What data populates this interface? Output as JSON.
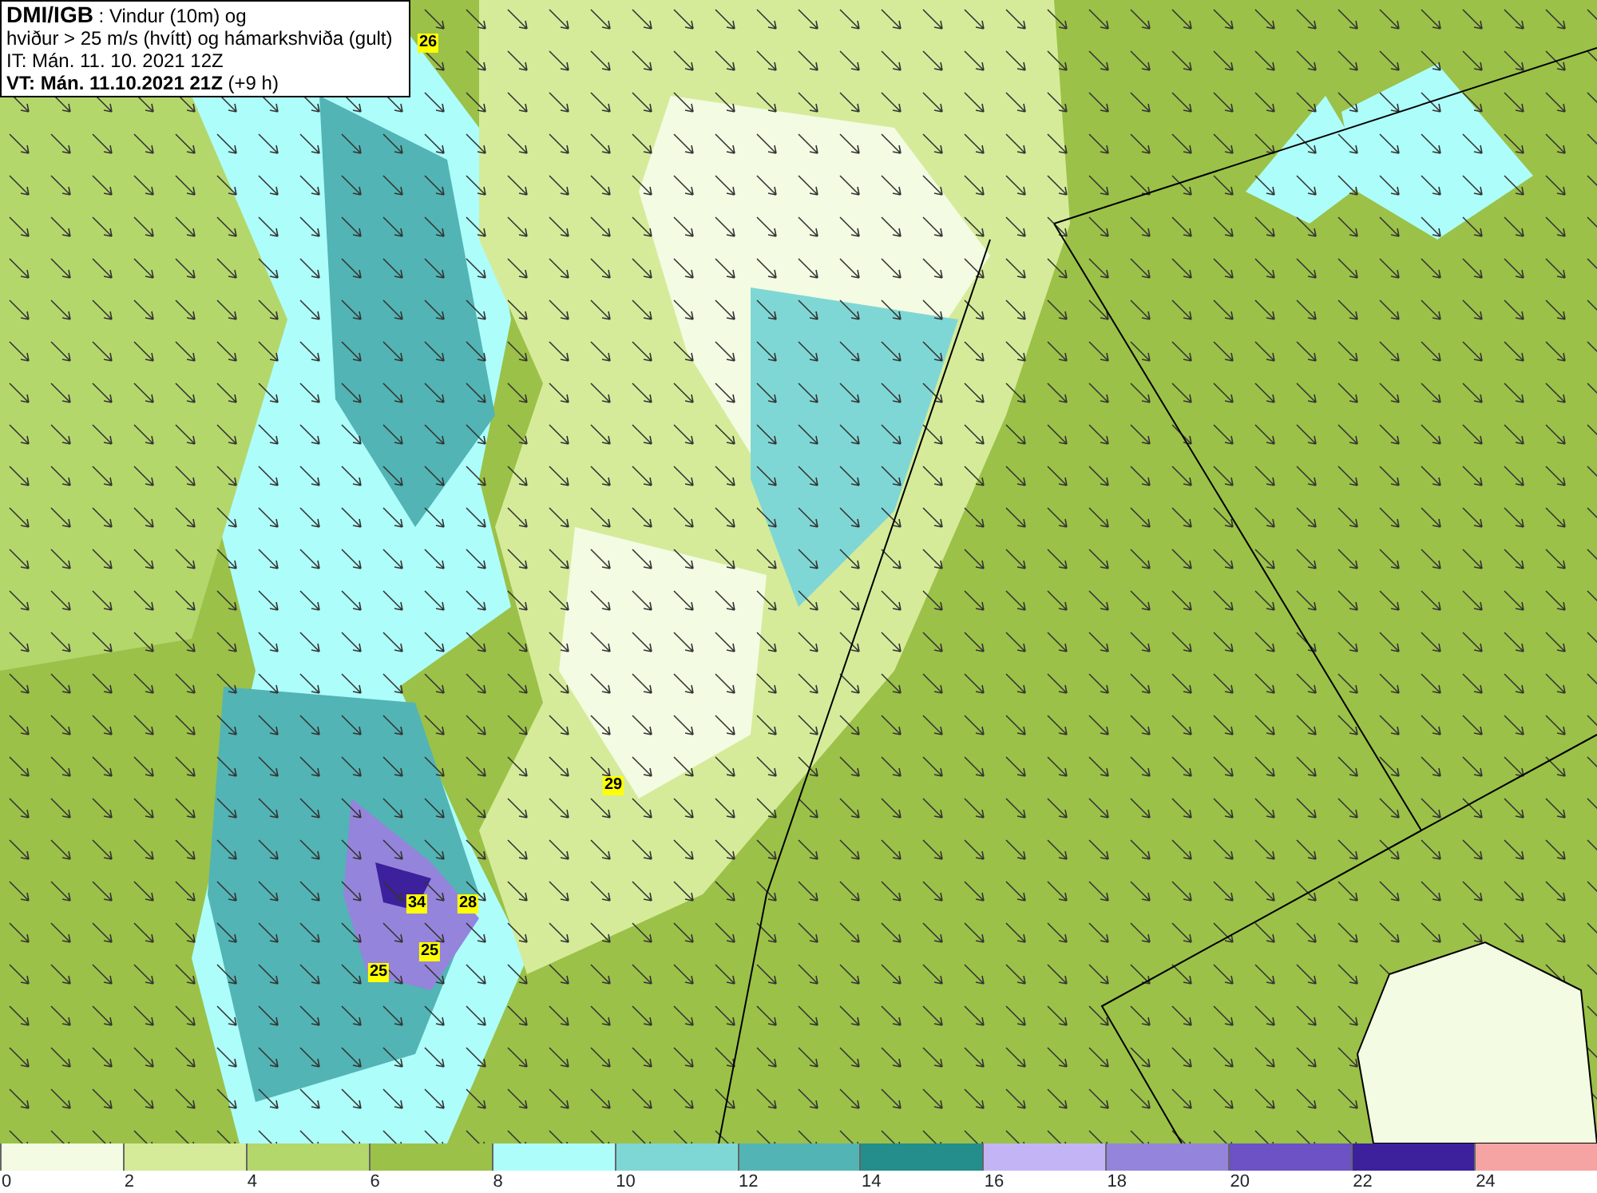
{
  "title_box": {
    "lines": [
      {
        "text": "**DMI/IGB** : Vindur (10m) og"
      },
      {
        "text": "hviður > 25 m/s (hvítt) og hámarkshviða (gult)"
      },
      {
        "text": "IT: Mán. 11. 10. 2021 12Z"
      },
      {
        "text": "**VT: Mán. 11.10.2021 21Z** (+9 h)"
      }
    ]
  },
  "gust_labels": [
    {
      "value": "26"
    },
    {
      "value": "29"
    },
    {
      "value": "34"
    },
    {
      "value": "28"
    },
    {
      "value": "25"
    },
    {
      "value": "25"
    }
  ],
  "legend": {
    "bins": [
      {
        "label": "0",
        "color": "#f3fbe2"
      },
      {
        "label": "2",
        "color": "#d5eb9a"
      },
      {
        "label": "4",
        "color": "#b4d76c"
      },
      {
        "label": "6",
        "color": "#9bc148"
      },
      {
        "label": "8",
        "color": "#adfdfa"
      },
      {
        "label": "10",
        "color": "#7fd7d5"
      },
      {
        "label": "12",
        "color": "#52b4b4"
      },
      {
        "label": "14",
        "color": "#238e8b"
      },
      {
        "label": "16",
        "color": "#c3b5f5"
      },
      {
        "label": "18",
        "color": "#9584db"
      },
      {
        "label": "20",
        "color": "#6c52c4"
      },
      {
        "label": "22",
        "color": "#3c209c"
      },
      {
        "label": "24",
        "color": "#f5a3a3"
      }
    ]
  }
}
